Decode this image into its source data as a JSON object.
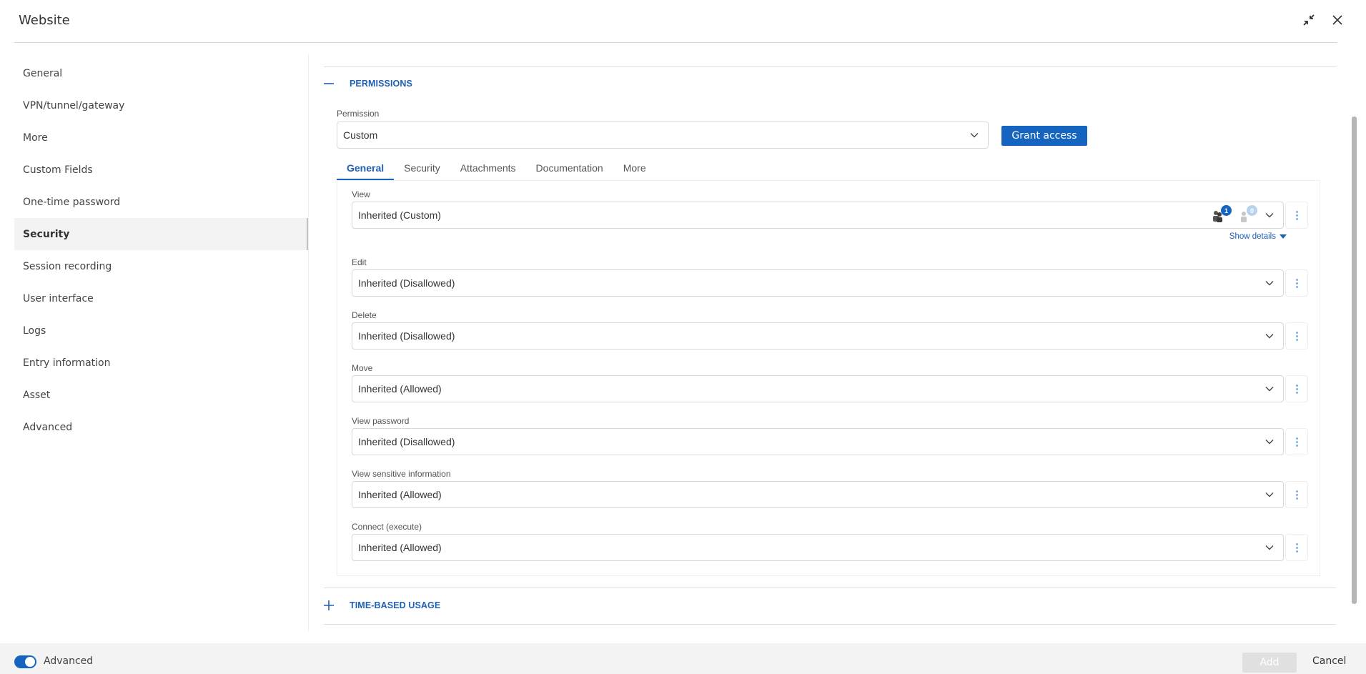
{
  "window": {
    "title": "Website",
    "icons": [
      "collapse-icon",
      "close-icon"
    ]
  },
  "sidebar": {
    "items": [
      {
        "label": "General",
        "active": false
      },
      {
        "label": "VPN/tunnel/gateway",
        "active": false
      },
      {
        "label": "More",
        "active": false
      },
      {
        "label": "Custom Fields",
        "active": false
      },
      {
        "label": "One-time password",
        "active": false
      },
      {
        "label": "Security",
        "active": true
      },
      {
        "label": "Session recording",
        "active": false
      },
      {
        "label": "User interface",
        "active": false
      },
      {
        "label": "Logs",
        "active": false
      },
      {
        "label": "Entry information",
        "active": false
      },
      {
        "label": "Asset",
        "active": false
      },
      {
        "label": "Advanced",
        "active": false
      }
    ]
  },
  "permissions": {
    "section_title": "PERMISSIONS",
    "expanded": true,
    "permission_label": "Permission",
    "permission_value": "Custom",
    "grant_access_label": "Grant access",
    "tabs": [
      {
        "label": "General",
        "active": true
      },
      {
        "label": "Security",
        "active": false
      },
      {
        "label": "Attachments",
        "active": false
      },
      {
        "label": "Documentation",
        "active": false
      },
      {
        "label": "More",
        "active": false
      }
    ],
    "rows": [
      {
        "label": "View",
        "value": "Inherited (Custom)",
        "users_count": "1",
        "roles_count": "0",
        "show_details": "Show details"
      },
      {
        "label": "Edit",
        "value": "Inherited (Disallowed)"
      },
      {
        "label": "Delete",
        "value": "Inherited (Disallowed)"
      },
      {
        "label": "Move",
        "value": "Inherited (Allowed)"
      },
      {
        "label": "View password",
        "value": "Inherited (Disallowed)"
      },
      {
        "label": "View sensitive information",
        "value": "Inherited (Allowed)"
      },
      {
        "label": "Connect (execute)",
        "value": "Inherited (Allowed)"
      }
    ]
  },
  "time_based_usage": {
    "section_title": "TIME-BASED USAGE",
    "expanded": false
  },
  "footer": {
    "advanced_label": "Advanced",
    "advanced_on": true,
    "add_label": "Add",
    "add_enabled": false,
    "cancel_label": "Cancel"
  },
  "colors": {
    "accent": "#1565c0",
    "section_title": "#1f5fb4",
    "active_bg": "#f3f3f3"
  }
}
